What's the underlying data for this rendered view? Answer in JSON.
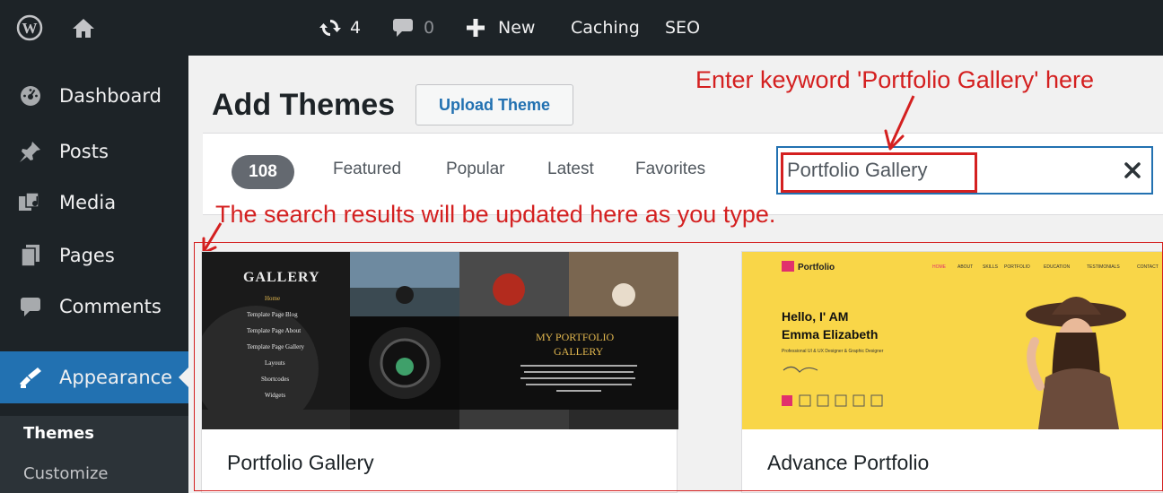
{
  "admin_bar": {
    "updates_count": "4",
    "comments_count": "0",
    "new_label": "New",
    "caching_label": "Caching",
    "seo_label": "SEO"
  },
  "sidebar": {
    "items": [
      {
        "label": "Dashboard",
        "icon": "dashboard-icon"
      },
      {
        "label": "Posts",
        "icon": "pin-icon"
      },
      {
        "label": "Media",
        "icon": "media-icon"
      },
      {
        "label": "Pages",
        "icon": "pages-icon"
      },
      {
        "label": "Comments",
        "icon": "comment-icon"
      },
      {
        "label": "Appearance",
        "icon": "brush-icon"
      }
    ],
    "submenu": [
      {
        "label": "Themes"
      },
      {
        "label": "Customize"
      }
    ],
    "active_color": "#2271b1"
  },
  "page": {
    "title": "Add Themes",
    "upload_button": "Upload Theme"
  },
  "filters": {
    "count": "108",
    "links": [
      "Featured",
      "Popular",
      "Latest",
      "Favorites"
    ]
  },
  "search": {
    "value": "Portfolio Gallery"
  },
  "annotations": {
    "keyword_hint": "Enter keyword 'Portfolio Gallery' here",
    "results_hint": "The search results will be updated here as you type.",
    "color": "#d42020"
  },
  "themes": [
    {
      "name": "Portfolio Gallery",
      "preview": {
        "logo": "GALLERY",
        "menu": [
          "Home",
          "Template Page Blog",
          "Template Page About",
          "Template Page Gallery",
          "Layouts",
          "Shortcodes",
          "Widgets"
        ],
        "heading_line1": "MY PORTFOLIO",
        "heading_line2": "GALLERY"
      }
    },
    {
      "name": "Advance Portfolio",
      "preview": {
        "brand": "Portfolio",
        "nav": [
          "HOME",
          "ABOUT",
          "SKILLS",
          "PORTFOLIO",
          "EDUCATION",
          "TESTIMONIALS",
          "CONTACT"
        ],
        "greeting": "Hello, I' AM",
        "person": "Emma Elizabeth",
        "tagline": "Professional UI & UX Designer & Graphic Designer",
        "accent": "#f9d648"
      }
    }
  ]
}
